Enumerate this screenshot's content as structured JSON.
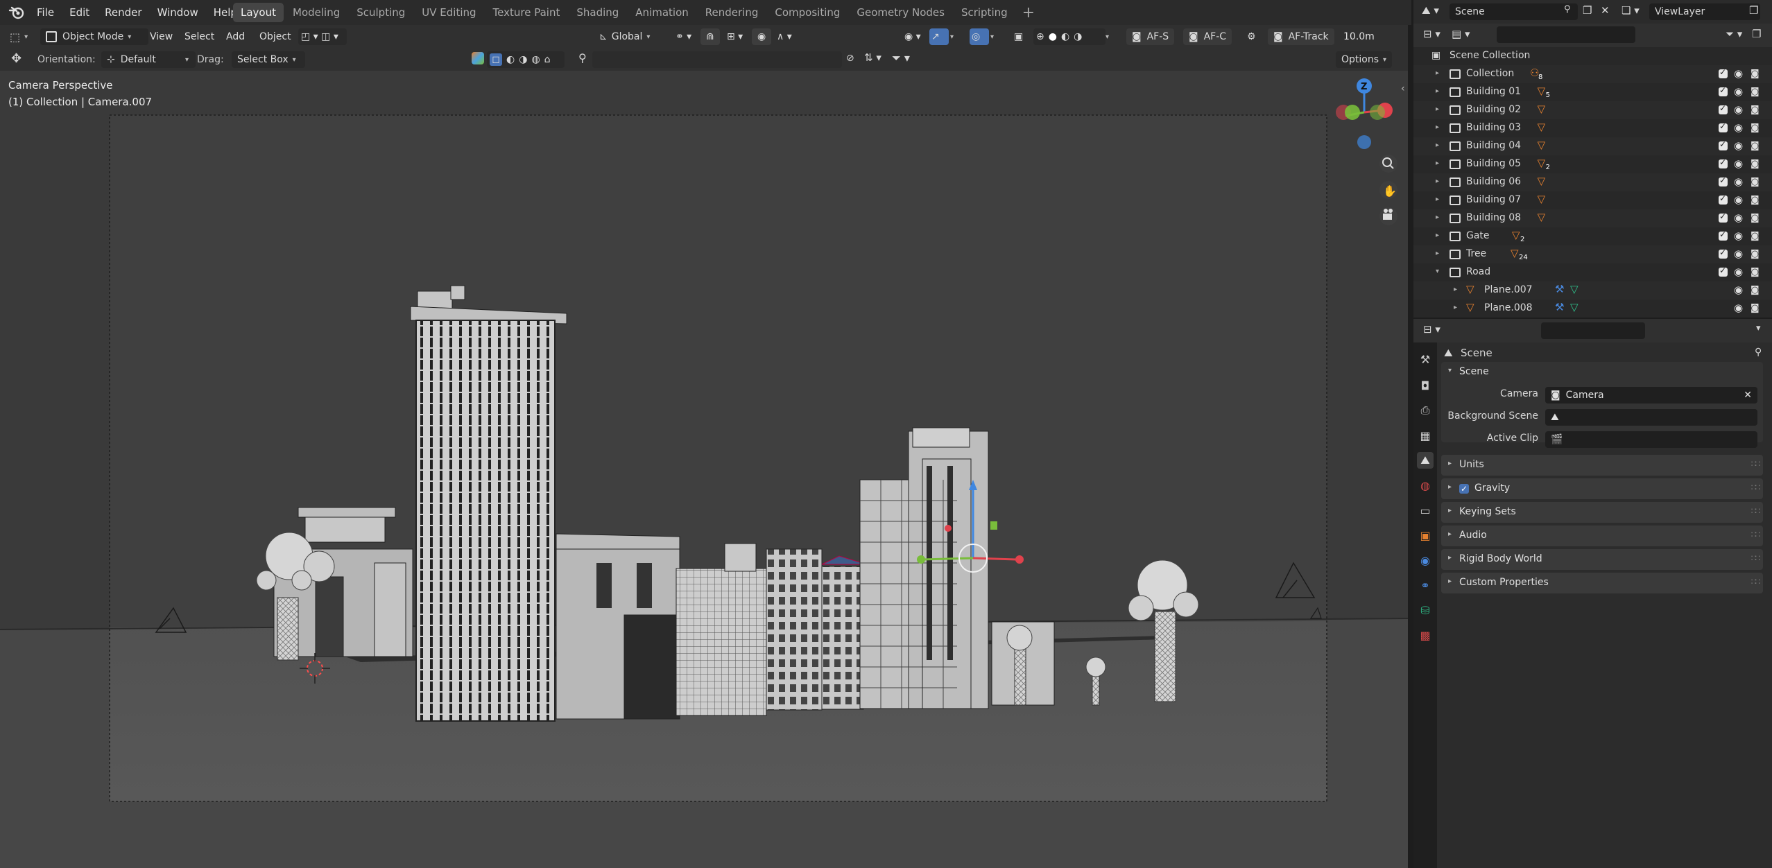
{
  "menu": {
    "items": [
      "File",
      "Edit",
      "Render",
      "Window",
      "Help"
    ]
  },
  "workspaces": [
    "Layout",
    "Modeling",
    "Sculpting",
    "UV Editing",
    "Texture Paint",
    "Shading",
    "Animation",
    "Rendering",
    "Compositing",
    "Geometry Nodes",
    "Scripting"
  ],
  "workspace_active": "Layout",
  "header": {
    "mode": "Object Mode",
    "view": "View",
    "select": "Select",
    "add": "Add",
    "object": "Object",
    "transform_orientation": "Global",
    "af_s": "AF-S",
    "af_c": "AF-C",
    "af_track": "AF-Track",
    "distance": "10.0m"
  },
  "toolsettings": {
    "orientation_label": "Orientation:",
    "orientation_value": "Default",
    "drag_label": "Drag:",
    "drag_value": "Select Box",
    "options": "Options"
  },
  "viewport": {
    "title": "Camera Perspective",
    "subtitle": "(1) Collection | Camera.007",
    "gizmo_z": "Z"
  },
  "topright": {
    "scene": "Scene",
    "view_layer": "ViewLayer"
  },
  "outliner": {
    "root": "Scene Collection",
    "rows": [
      {
        "name": "Collection",
        "badge": "8",
        "kind": "collection"
      },
      {
        "name": "Building 01",
        "badge": "5",
        "kind": "mesh"
      },
      {
        "name": "Building 02",
        "badge": "",
        "kind": "mesh"
      },
      {
        "name": "Building 03",
        "badge": "",
        "kind": "mesh"
      },
      {
        "name": "Building 04",
        "badge": "",
        "kind": "mesh"
      },
      {
        "name": "Building 05",
        "badge": "2",
        "kind": "mesh"
      },
      {
        "name": "Building 06",
        "badge": "",
        "kind": "mesh"
      },
      {
        "name": "Building 07",
        "badge": "",
        "kind": "mesh"
      },
      {
        "name": "Building 08",
        "badge": "",
        "kind": "mesh"
      },
      {
        "name": "Gate",
        "badge": "2",
        "kind": "mesh"
      },
      {
        "name": "Tree",
        "badge": "24",
        "kind": "mesh"
      },
      {
        "name": "Road",
        "badge": "",
        "kind": "collection-open"
      },
      {
        "name": "Plane.007",
        "badge": "",
        "kind": "child"
      },
      {
        "name": "Plane.008",
        "badge": "",
        "kind": "child"
      }
    ]
  },
  "properties": {
    "context": "Scene",
    "panel_scene": "Scene",
    "fields": {
      "camera_label": "Camera",
      "camera_value": "Camera",
      "background_label": "Background Scene",
      "active_clip_label": "Active Clip"
    },
    "panels": [
      "Units",
      "Gravity",
      "Keying Sets",
      "Audio",
      "Rigid Body World",
      "Custom Properties"
    ]
  },
  "colors": {
    "accent": "#4772b3",
    "object_orange": "#e6812f",
    "x_axis": "#e0424c",
    "y_axis": "#79bd3b",
    "z_axis": "#3f87e0"
  }
}
